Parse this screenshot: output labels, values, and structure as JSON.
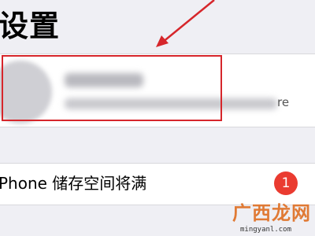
{
  "header": {
    "title": "设置"
  },
  "account": {
    "trailing_text": "re"
  },
  "storage_row": {
    "label": "Phone 储存空间将满",
    "badge_count": "1"
  },
  "watermark": {
    "logo_text": "广西龙网",
    "url": "mingyanl.com"
  },
  "colors": {
    "background": "#efeff4",
    "annotation_red": "#d6262b",
    "badge_red": "#ea3b30",
    "watermark_orange": "#e07a35"
  }
}
